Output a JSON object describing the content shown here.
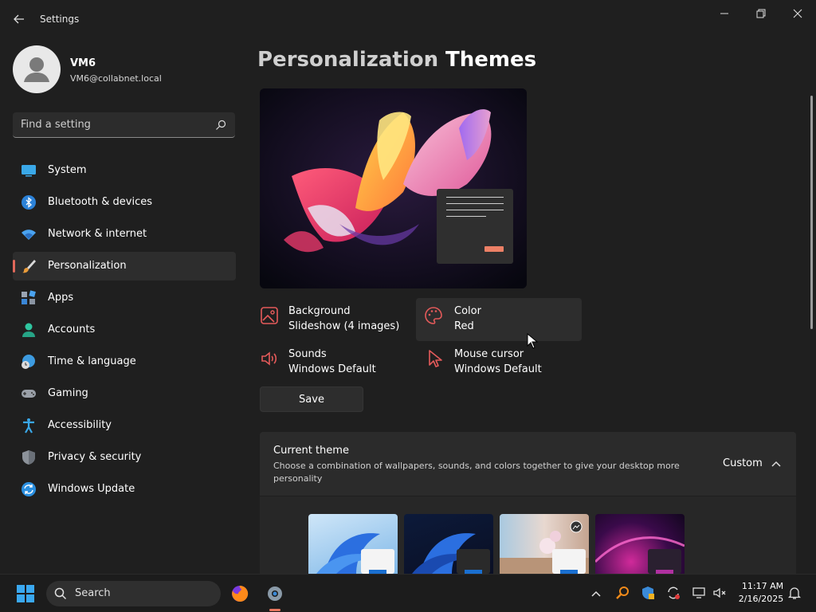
{
  "window": {
    "title": "Settings",
    "controls": [
      "minimize",
      "restore",
      "close"
    ]
  },
  "user": {
    "name": "VM6",
    "email": "VM6@collabnet.local"
  },
  "search": {
    "placeholder": "Find a setting"
  },
  "sidebar": {
    "items": [
      {
        "label": "System",
        "icon": "monitor-icon"
      },
      {
        "label": "Bluetooth & devices",
        "icon": "bluetooth-icon"
      },
      {
        "label": "Network & internet",
        "icon": "wifi-icon"
      },
      {
        "label": "Personalization",
        "icon": "paintbrush-icon",
        "active": true
      },
      {
        "label": "Apps",
        "icon": "apps-icon"
      },
      {
        "label": "Accounts",
        "icon": "person-icon"
      },
      {
        "label": "Time & language",
        "icon": "globe-clock-icon"
      },
      {
        "label": "Gaming",
        "icon": "gamepad-icon"
      },
      {
        "label": "Accessibility",
        "icon": "accessibility-icon"
      },
      {
        "label": "Privacy & security",
        "icon": "shield-icon"
      },
      {
        "label": "Windows Update",
        "icon": "update-icon"
      }
    ]
  },
  "breadcrumb": {
    "parent": "Personalization",
    "current": "Themes"
  },
  "theme_props": {
    "background": {
      "title": "Background",
      "value": "Slideshow (4 images)"
    },
    "color": {
      "title": "Color",
      "value": "Red"
    },
    "sounds": {
      "title": "Sounds",
      "value": "Windows Default"
    },
    "cursor": {
      "title": "Mouse cursor",
      "value": "Windows Default"
    }
  },
  "save_label": "Save",
  "current_theme": {
    "title": "Current theme",
    "description": "Choose a combination of wallpapers, sounds, and colors together to give your desktop more personality",
    "value": "Custom"
  },
  "taskbar": {
    "search_label": "Search",
    "time": "11:17 AM",
    "date": "2/16/2025"
  },
  "colors": {
    "accent": "#e0685a",
    "background": "#1f1f1f",
    "card": "#2b2b2b"
  }
}
